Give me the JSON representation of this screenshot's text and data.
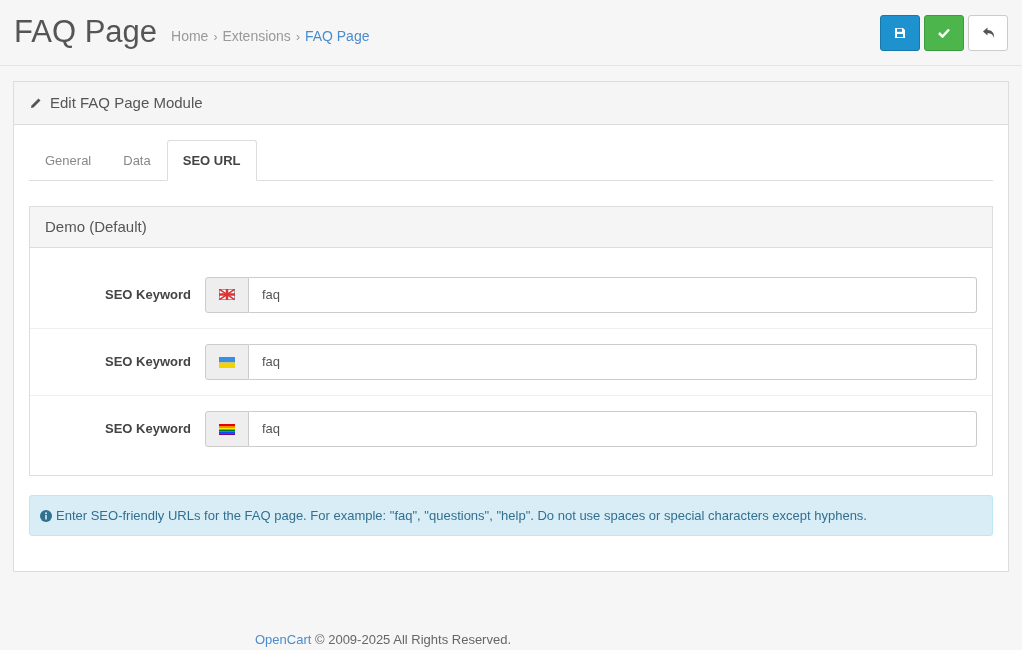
{
  "header": {
    "title": "FAQ Page",
    "breadcrumb": [
      {
        "label": "Home",
        "current": false
      },
      {
        "label": "Extensions",
        "current": false
      },
      {
        "label": "FAQ Page",
        "current": true
      }
    ],
    "separator": "›",
    "buttons": [
      {
        "kind": "save"
      },
      {
        "kind": "apply"
      },
      {
        "kind": "back"
      }
    ]
  },
  "panel": {
    "title": "Edit FAQ Page Module",
    "tabs": [
      {
        "label": "General",
        "selected": false
      },
      {
        "label": "Data",
        "selected": false
      },
      {
        "label": "SEO URL",
        "selected": true
      }
    ],
    "store": {
      "title": "Demo (Default)",
      "fields": [
        {
          "label": "SEO Keyword",
          "kind": "union",
          "value": "faq"
        },
        {
          "label": "SEO Keyword",
          "kind": "bicolor",
          "value": "faq"
        },
        {
          "label": "SEO Keyword",
          "kind": "rainbow",
          "value": "faq"
        }
      ]
    },
    "alert": "Enter SEO-friendly URLs for the FAQ page. For example: \"faq\", \"questions\", \"help\". Do not use spaces or special characters except hyphens."
  },
  "footer": {
    "link": "OpenCart",
    "text": "© 2009-2025 All Rights Reserved."
  }
}
